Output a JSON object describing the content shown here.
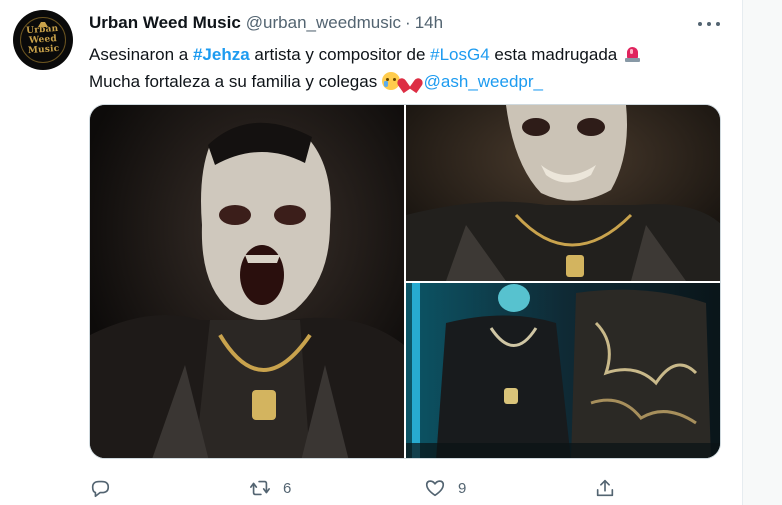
{
  "tweet": {
    "author": {
      "name": "Urban Weed Music",
      "handle": "@urban_weedmusic",
      "avatar_text": "Urban Weed Music"
    },
    "separator": "·",
    "time": "14h",
    "text": {
      "line1_prefix": "Asesinaron a ",
      "hashtag1": "#Jehza",
      "line1_middle": " artista y compositor de ",
      "hashtag2": "#LosG4",
      "line1_suffix": " esta madrugada",
      "line1_emoji": "police-car-light",
      "line2_prefix": "Mucha fortaleza a su familia y colegas ",
      "line2_emojis": [
        "crying-face",
        "broken-heart"
      ],
      "mention": "@ash_weedpr_"
    },
    "media": {
      "count": 3,
      "photos": [
        {
          "description_icon": "photo",
          "subject": "man with face paint and chain"
        },
        {
          "description_icon": "photo",
          "subject": "man with face paint smiling"
        },
        {
          "description_icon": "photo",
          "subject": "two men in neon light"
        }
      ]
    },
    "actions": {
      "reply": {
        "icon": "reply-icon",
        "count": ""
      },
      "retweet": {
        "icon": "retweet-icon",
        "count": "6"
      },
      "like": {
        "icon": "heart-icon",
        "count": "9"
      },
      "share": {
        "icon": "share-icon",
        "count": ""
      }
    }
  },
  "colors": {
    "text": "#0f1419",
    "secondary": "#536471",
    "link": "#1d9bf0",
    "divider": "#e6ecf0"
  }
}
